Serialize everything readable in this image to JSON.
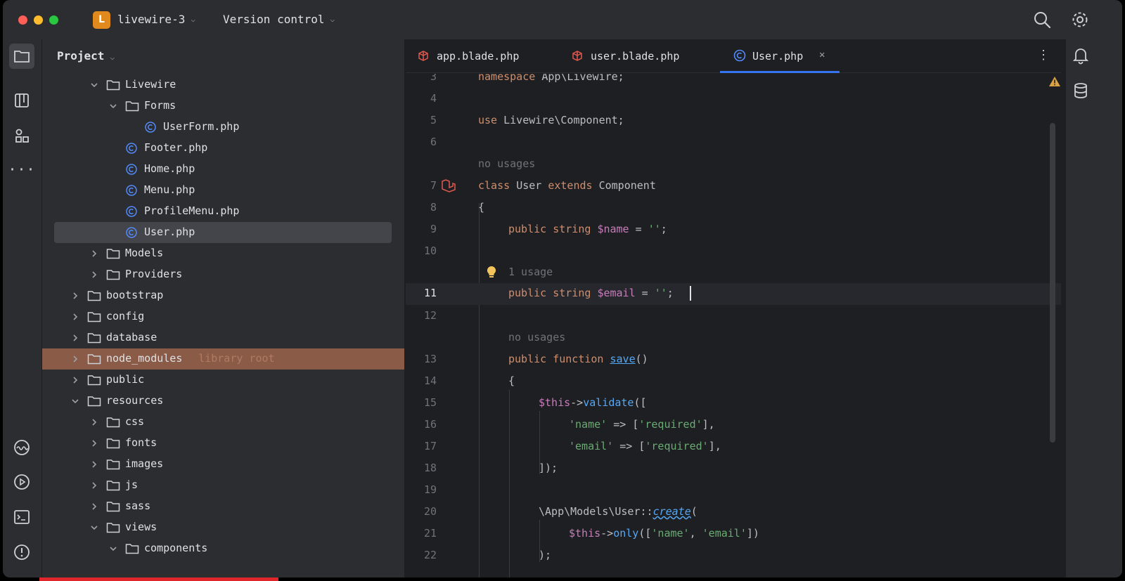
{
  "titlebar": {
    "project_initial": "L",
    "project_name": "livewire-3",
    "vcs_label": "Version control"
  },
  "project_panel": {
    "title": "Project",
    "items": [
      {
        "label": "Livewire",
        "type": "folder",
        "expanded": true
      },
      {
        "label": "Forms",
        "type": "folder",
        "expanded": true
      },
      {
        "label": "UserForm.php",
        "type": "php-class"
      },
      {
        "label": "Footer.php",
        "type": "php-class"
      },
      {
        "label": "Home.php",
        "type": "php-class"
      },
      {
        "label": "Menu.php",
        "type": "php-class"
      },
      {
        "label": "ProfileMenu.php",
        "type": "php-class"
      },
      {
        "label": "User.php",
        "type": "php-class",
        "selected": true
      },
      {
        "label": "Models",
        "type": "folder",
        "expanded": false
      },
      {
        "label": "Providers",
        "type": "folder",
        "expanded": false
      },
      {
        "label": "bootstrap",
        "type": "folder",
        "expanded": false
      },
      {
        "label": "config",
        "type": "folder",
        "expanded": false
      },
      {
        "label": "database",
        "type": "folder",
        "expanded": false
      },
      {
        "label": "node_modules",
        "type": "folder",
        "expanded": false,
        "sub": "library root"
      },
      {
        "label": "public",
        "type": "folder",
        "expanded": false
      },
      {
        "label": "resources",
        "type": "folder",
        "expanded": true
      },
      {
        "label": "css",
        "type": "folder",
        "expanded": false
      },
      {
        "label": "fonts",
        "type": "folder",
        "expanded": false
      },
      {
        "label": "images",
        "type": "folder",
        "expanded": false
      },
      {
        "label": "js",
        "type": "folder",
        "expanded": false
      },
      {
        "label": "sass",
        "type": "folder",
        "expanded": false
      },
      {
        "label": "views",
        "type": "folder",
        "expanded": true
      },
      {
        "label": "components",
        "type": "folder",
        "expanded": true
      }
    ]
  },
  "tabs": [
    {
      "label": "app.blade.php",
      "type": "blade"
    },
    {
      "label": "user.blade.php",
      "type": "blade"
    },
    {
      "label": "User.php",
      "type": "php-class",
      "active": true
    }
  ],
  "editor": {
    "lines": [
      {
        "n": "3",
        "text": "namespace App\\Livewire;"
      },
      {
        "n": "4",
        "text": ""
      },
      {
        "n": "5",
        "text": "use Livewire\\Component;"
      },
      {
        "n": "6",
        "text": ""
      },
      {
        "hint": "no usages"
      },
      {
        "n": "7",
        "text": "class User extends Component"
      },
      {
        "n": "8",
        "text": "{"
      },
      {
        "n": "9",
        "text": "public string $name = '';"
      },
      {
        "n": "10",
        "text": ""
      },
      {
        "hint": "1 usage"
      },
      {
        "n": "11",
        "text": "public string $email = '';"
      },
      {
        "n": "12",
        "text": ""
      },
      {
        "hint": "no usages"
      },
      {
        "n": "13",
        "text": "public function save()"
      },
      {
        "n": "14",
        "text": "{"
      },
      {
        "n": "15",
        "text": "$this->validate(["
      },
      {
        "n": "16",
        "text": "'name' => ['required'],"
      },
      {
        "n": "17",
        "text": "'email' => ['required'],"
      },
      {
        "n": "18",
        "text": "]);"
      },
      {
        "n": "19",
        "text": ""
      },
      {
        "n": "20",
        "text": "\\App\\Models\\User::create("
      },
      {
        "n": "21",
        "text": "$this->only(['name', 'email'])"
      },
      {
        "n": "22",
        "text": ");"
      }
    ],
    "tokens": {
      "namespace": "namespace",
      "ns_path": "App\\Livewire;",
      "use": "use",
      "use_path": "Livewire\\Component;",
      "class": "class",
      "class_name": "User",
      "extends": "extends",
      "parent": "Component",
      "brace_open": "{",
      "public": "public",
      "string": "string",
      "name_var": "$name",
      "email_var": "$email",
      "assign": " = ",
      "empty_str": "''",
      "semi": ";",
      "function": "function",
      "save": "save",
      "parens": "()",
      "this": "$this",
      "arrow": "->",
      "validate": "validate",
      "open_bracket": "([",
      "key_name": "'name'",
      "key_email": "'email'",
      "fat_arrow": " => ",
      "required_arr_open": "[",
      "required": "'required'",
      "required_arr_close": "],",
      "close_validate": "]);",
      "model_path": "\\App\\Models\\User::",
      "create": "create",
      "open_paren": "(",
      "only": "only",
      "only_open": "([",
      "comma_sp": ", ",
      "only_close": "])",
      "close_create": ");"
    }
  },
  "colors": {
    "accent": "#3574f0",
    "selection": "#43454a",
    "ignored_highlight": "#8a5b47",
    "keyword": "#cf8e6d",
    "variable": "#c77dbb",
    "string": "#6aab73",
    "function": "#56a8f5"
  }
}
